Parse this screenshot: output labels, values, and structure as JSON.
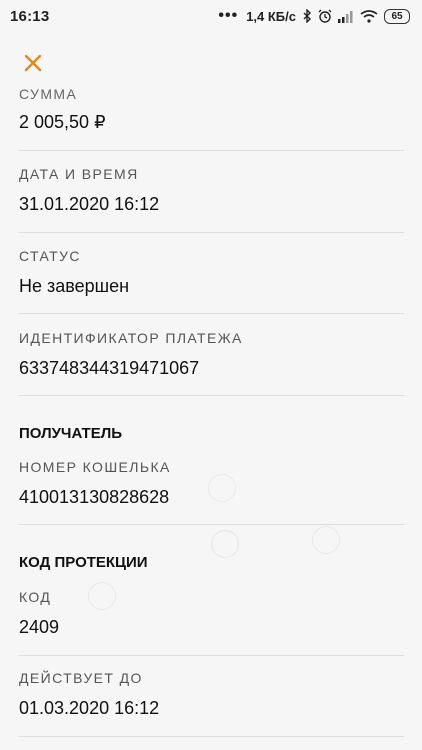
{
  "status_bar": {
    "time": "16:13",
    "dots": "•••",
    "speed": "1,4 КБ/с",
    "battery": "65",
    "icons": [
      "bluetooth-icon",
      "alarm-icon",
      "signal-icon",
      "wifi-icon",
      "battery-icon"
    ]
  },
  "header": {
    "close_icon": "close-icon",
    "accent_color": "#e08a1e"
  },
  "amount": {
    "label": "СУММА",
    "value": "2 005,50 ₽"
  },
  "datetime": {
    "label": "ДАТА И ВРЕМЯ",
    "value": "31.01.2020 16:12"
  },
  "status": {
    "label": "СТАТУС",
    "value": "Не завершен"
  },
  "payment_id": {
    "label": "ИДЕНТИФИКАТОР ПЛАТЕЖА",
    "value": "633748344319471067"
  },
  "recipient": {
    "title": "ПОЛУЧАТЕЛЬ",
    "wallet_label": "НОМЕР КОШЕЛЬКА",
    "wallet_value": "410013130828628"
  },
  "protection": {
    "title": "КОД ПРОТЕКЦИИ",
    "code_label": "КОД",
    "code_value": "2409",
    "valid_label": "ДЕЙСТВУЕТ ДО",
    "valid_value": "01.03.2020 16:12"
  }
}
